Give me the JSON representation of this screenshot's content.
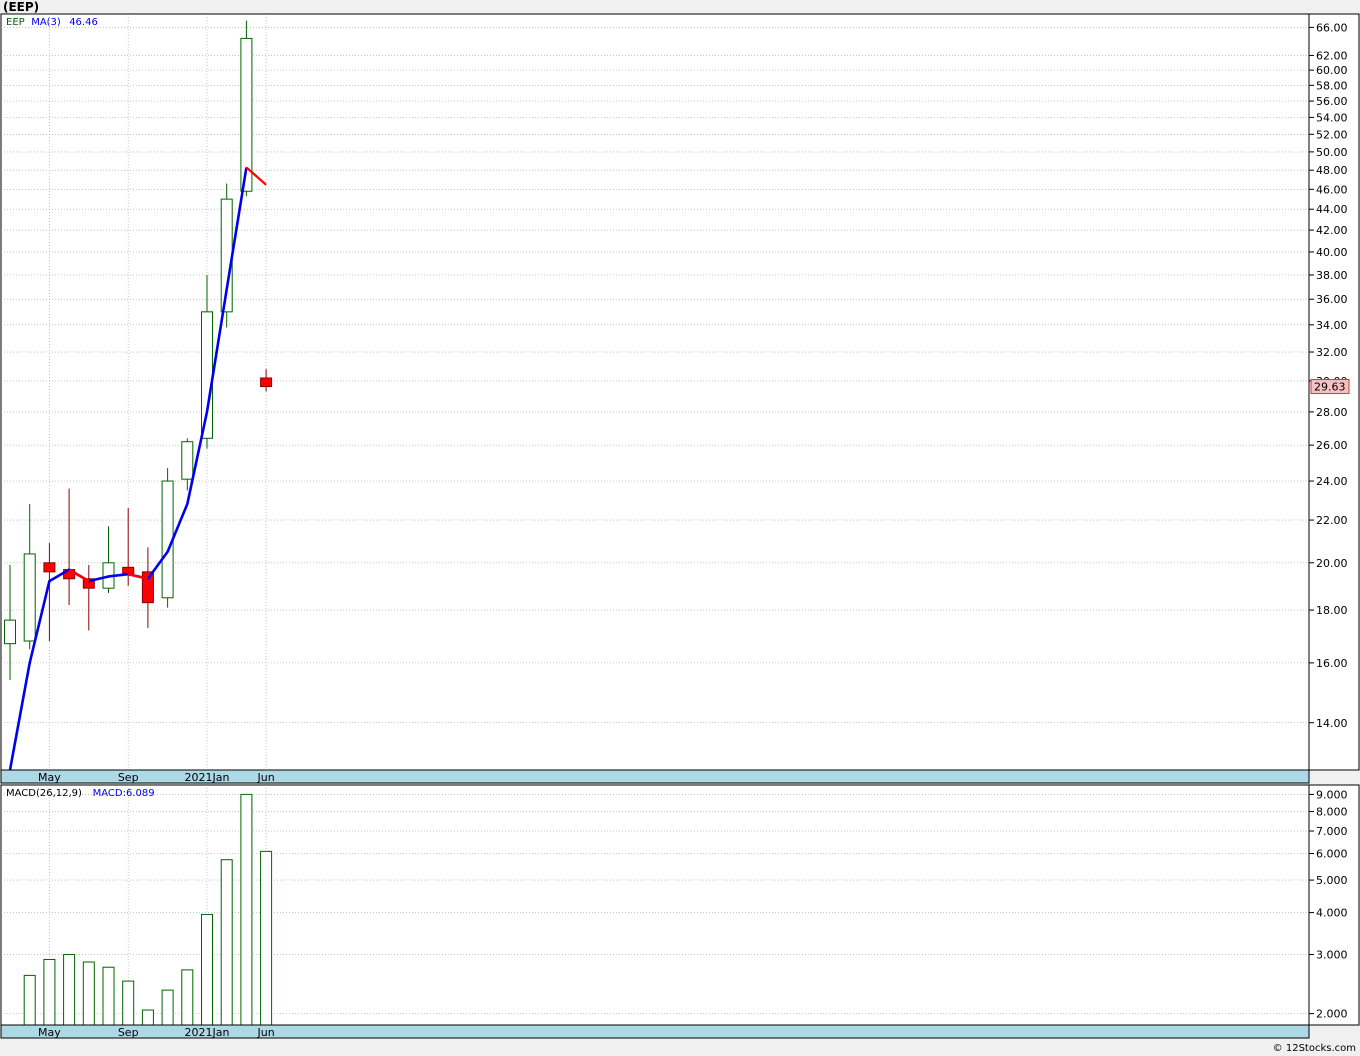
{
  "title": "(EEP)",
  "footer": "© 12Stocks.com",
  "colors": {
    "up": "#006400",
    "down": "#ff0000",
    "ma": "#0000ee",
    "ma_tail": "#ff0000",
    "macd": "#006400",
    "grid": "#a0a0a0",
    "axis_band": "#add8e6",
    "last_price_bg": "#f4c2c2",
    "last_price_border": "#c04040"
  },
  "chart_data": [
    {
      "type": "candlestick",
      "legend": [
        {
          "text": "EEP",
          "color": "#006400"
        },
        {
          "text": "MA(3)",
          "color": "#0000ee"
        },
        {
          "text": "46.46",
          "color": "#0000ee"
        }
      ],
      "y_scale": "log",
      "ylim": [
        12.6,
        68
      ],
      "y_ticks": [
        "14.00",
        "16.00",
        "18.00",
        "20.00",
        "22.00",
        "24.00",
        "26.00",
        "28.00",
        "30.00",
        "32.00",
        "34.00",
        "36.00",
        "38.00",
        "40.00",
        "42.00",
        "44.00",
        "46.00",
        "48.00",
        "50.00",
        "52.00",
        "54.00",
        "56.00",
        "58.00",
        "60.00",
        "62.00",
        "66.00"
      ],
      "last_price": "29.63",
      "x_ticks": [
        {
          "label": "May",
          "index": 2
        },
        {
          "label": "Sep",
          "index": 6
        },
        {
          "label": "2021Jan",
          "index": 10
        },
        {
          "label": "Jun",
          "index": 13
        }
      ],
      "candles": [
        {
          "open": 16.7,
          "high": 19.9,
          "low": 15.4,
          "close": 17.6
        },
        {
          "open": 16.8,
          "high": 22.8,
          "low": 16.5,
          "close": 20.4
        },
        {
          "open": 20.0,
          "high": 20.9,
          "low": 16.8,
          "close": 19.6
        },
        {
          "open": 19.7,
          "high": 23.6,
          "low": 18.2,
          "close": 19.3
        },
        {
          "open": 19.3,
          "high": 19.9,
          "low": 17.2,
          "close": 18.9
        },
        {
          "open": 18.9,
          "high": 21.7,
          "low": 18.7,
          "close": 20.0
        },
        {
          "open": 19.8,
          "high": 22.6,
          "low": 19.0,
          "close": 19.5
        },
        {
          "open": 19.6,
          "high": 20.7,
          "low": 17.3,
          "close": 18.3
        },
        {
          "open": 18.5,
          "high": 24.7,
          "low": 18.1,
          "close": 24.0
        },
        {
          "open": 24.1,
          "high": 26.4,
          "low": 23.5,
          "close": 26.2
        },
        {
          "open": 26.4,
          "high": 38.0,
          "low": 25.8,
          "close": 35.0
        },
        {
          "open": 35.0,
          "high": 46.6,
          "low": 33.8,
          "close": 45.0
        },
        {
          "open": 45.8,
          "high": 67.0,
          "low": 45.3,
          "close": 64.4
        },
        {
          "open": 30.2,
          "high": 30.8,
          "low": 29.3,
          "close": 29.63
        }
      ],
      "ma": [
        12.6,
        16.0,
        19.2,
        19.7,
        19.2,
        19.4,
        19.5,
        19.3,
        20.5,
        22.8,
        28.0,
        36.8,
        48.3,
        46.46
      ]
    },
    {
      "type": "bar",
      "legend": [
        {
          "text": "MACD(26,12,9)",
          "color": "#000000"
        },
        {
          "text": "MACD:6.089",
          "color": "#0000ee"
        }
      ],
      "y_scale": "log",
      "ylim": [
        1.85,
        9.6
      ],
      "y_ticks": [
        "2.000",
        "3.000",
        "4.000",
        "5.000",
        "6.000",
        "7.000",
        "8.000",
        "9.000"
      ],
      "x_ticks": [
        {
          "label": "May",
          "index": 2
        },
        {
          "label": "Sep",
          "index": 6
        },
        {
          "label": "2021Jan",
          "index": 10
        },
        {
          "label": "Jun",
          "index": 13
        }
      ],
      "values": [
        1.7,
        2.6,
        2.9,
        3.0,
        2.85,
        2.75,
        2.5,
        2.05,
        2.35,
        2.7,
        3.95,
        5.75,
        9.0,
        6.089
      ]
    }
  ]
}
